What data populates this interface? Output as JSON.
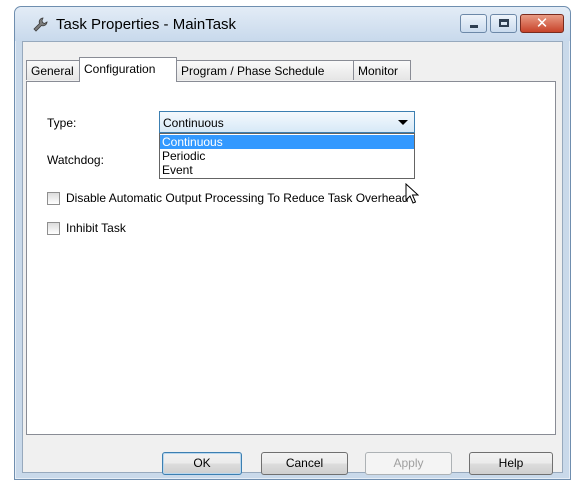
{
  "window": {
    "title": "Task Properties - MainTask"
  },
  "tabs": [
    {
      "label": "General"
    },
    {
      "label": "Configuration"
    },
    {
      "label": "Program / Phase Schedule"
    },
    {
      "label": "Monitor"
    }
  ],
  "config": {
    "type_label": "Type:",
    "type_value": "Continuous",
    "type_options": [
      "Continuous",
      "Periodic",
      "Event"
    ],
    "watchdog_label": "Watchdog:",
    "disable_output_label": "Disable Automatic Output Processing To Reduce Task Overhead",
    "disable_output_checked": false,
    "inhibit_label": "Inhibit Task",
    "inhibit_checked": false
  },
  "buttons": {
    "ok": "OK",
    "cancel": "Cancel",
    "apply": "Apply",
    "help": "Help"
  },
  "icons": {
    "app": "wrench-icon",
    "minimize": "minimize-icon",
    "maximize": "maximize-icon",
    "close": "close-icon",
    "cursor": "mouse-pointer-icon"
  }
}
